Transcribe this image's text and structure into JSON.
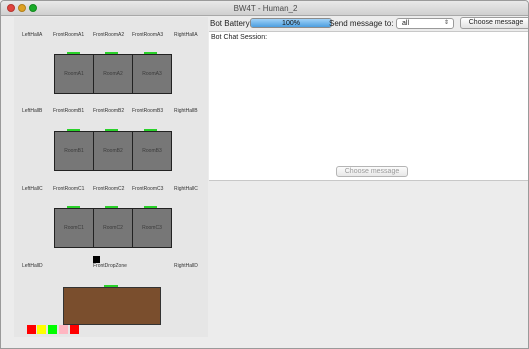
{
  "window": {
    "title": "BW4T - Human_2"
  },
  "map": {
    "rows": [
      {
        "left": "LeftHallA",
        "fronts": [
          "FrontRoomA1",
          "FrontRoomA2",
          "FrontRoomA3"
        ],
        "right": "RightHallA",
        "rooms": [
          "RoomA1",
          "RoomA2",
          "RoomA3"
        ]
      },
      {
        "left": "LeftHallB",
        "fronts": [
          "FrontRoomB1",
          "FrontRoomB2",
          "FrontRoomB3"
        ],
        "right": "RightHallB",
        "rooms": [
          "RoomB1",
          "RoomB2",
          "RoomB3"
        ]
      },
      {
        "left": "LeftHallC",
        "fronts": [
          "FrontRoomC1",
          "FrontRoomC2",
          "FrontRoomC3"
        ],
        "right": "RightHallC",
        "rooms": [
          "RoomC1",
          "RoomC2",
          "RoomC3"
        ]
      }
    ],
    "bottom_row": {
      "left": "LeftHallD",
      "center": "FrontDropZone",
      "right": "RightHallD"
    },
    "colors": {
      "room": "#777777",
      "door": "#2ad12a",
      "dropzone": "#7a4e2d",
      "robot": "#000000"
    },
    "sequence_blocks": [
      "#ff0000",
      "#ffff00",
      "#00ff00",
      "#ffb6c1",
      "#ff0000"
    ]
  },
  "controls": {
    "battery_label": "Bot Battery:",
    "battery_value": "100%",
    "battery_fraction": 1.0,
    "send_label": "Send message to:",
    "recipient_selected": "all",
    "choose_top": "Choose message",
    "chat_label": "Bot Chat Session:",
    "choose_bottom": "Choose message",
    "icons": {
      "recipient_dropdown": "up-down-chevron-icon"
    }
  }
}
